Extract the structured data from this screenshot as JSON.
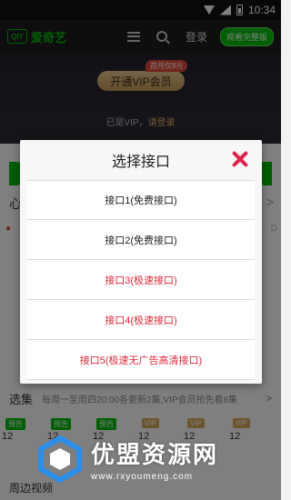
{
  "status_bar": {
    "time": "10:34"
  },
  "header": {
    "logo_mark": "QIY",
    "logo_text": "爱奇艺",
    "login_label": "登录",
    "watch_full_label": "观看完整版"
  },
  "vip": {
    "price_badge": "首月仅8元",
    "button_label": "开通VIP会员",
    "status_prefix": "已是VIP，",
    "status_login": "请登录"
  },
  "background": {
    "left_char": "心",
    "right_arrow": ">",
    "left_mark": "●",
    "right_mark": "D"
  },
  "episodes": {
    "label": "选集",
    "description": "每周一至周四20:00各更新2集;VIP会员抢先看8集",
    "arrow": ">",
    "tags": [
      "预告",
      "预告",
      "预告",
      "VIP",
      "VIP",
      "VIP"
    ],
    "numbers": [
      "12",
      "12",
      "12",
      "12",
      "12",
      "12"
    ]
  },
  "nearby": {
    "label": "周边视频"
  },
  "dialog": {
    "title": "选择接口",
    "options": [
      {
        "label": "接口1(免费接口)",
        "kind": "normal"
      },
      {
        "label": "接口2(免费接口)",
        "kind": "normal"
      },
      {
        "label": "接口3(极速接口)",
        "kind": "fast"
      },
      {
        "label": "接口4(极速接口)",
        "kind": "fast"
      },
      {
        "label": "接口5(极速无广告高清接口)",
        "kind": "fast"
      }
    ]
  },
  "watermark": {
    "title": "优盟资源网",
    "url": "www.rxyoumeng.com"
  },
  "colors": {
    "brand_green": "#00be06",
    "accent_red": "#e02a3a",
    "vip_gold": "#d8aa5a"
  }
}
